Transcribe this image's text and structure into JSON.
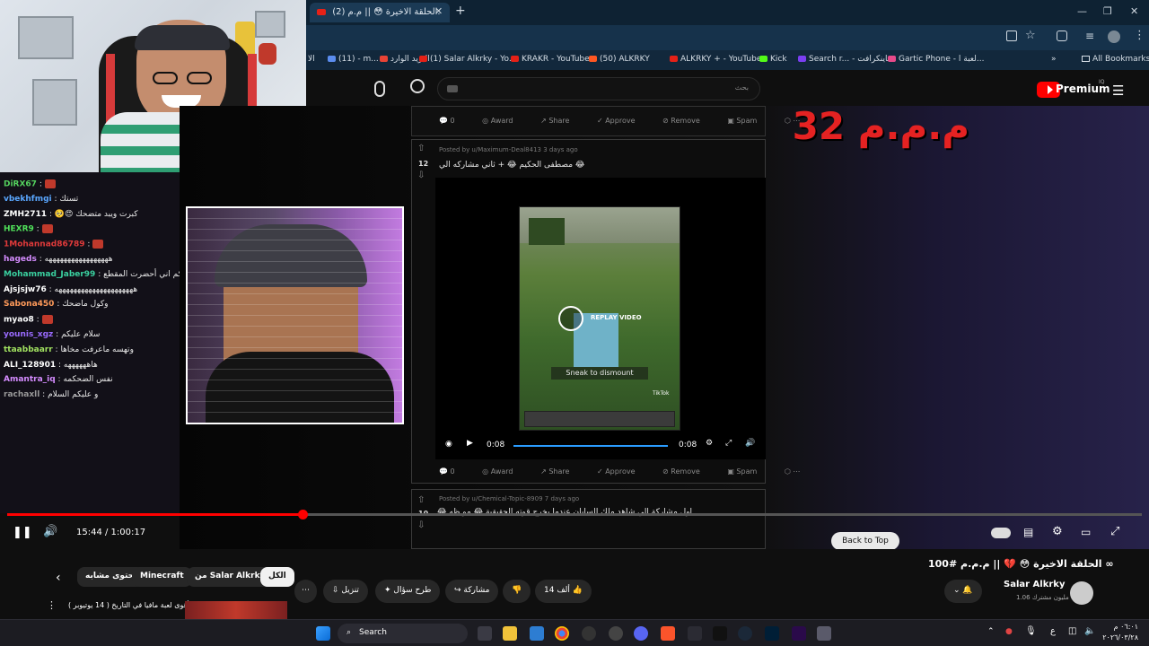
{
  "browser": {
    "tab_title": "(2) الحلقة الاخيرة 😳 || م.م.",
    "new_tab": "+",
    "window_controls": [
      "—",
      "❐",
      "✕"
    ],
    "bookmarks": [
      {
        "label": "الا"
      },
      {
        "label": "(11) - m..."
      },
      {
        "label": "البريد الوارد"
      },
      {
        "label": "(1) Salar Alkrky - Yo..."
      },
      {
        "label": "KRAKR - YouTube"
      },
      {
        "label": "(50) ALKRKY"
      },
      {
        "label": "ALKRKY + - YouTube"
      },
      {
        "label": "Kick"
      },
      {
        "label": "Search r... - ماينكرافت"
      },
      {
        "label": "Gartic Phone - لعبة ا..."
      },
      {
        "label": "All Bookmarks"
      }
    ]
  },
  "youtube": {
    "search_placeholder": "بحث",
    "premium_label": "Premium",
    "premium_badge": "IQ"
  },
  "chat": [
    {
      "user": "DiRX67",
      "msg": "",
      "color": "#54d15e"
    },
    {
      "user": "vbekhfmgi",
      "msg": "تستك",
      "color": "#5aa7ff"
    },
    {
      "user": "ZMH2711",
      "msg": "🥺😍 كبرت ويبد متضحك",
      "color": "#ffffff"
    },
    {
      "user": "HEXR9",
      "msg": "",
      "color": "#50e05a"
    },
    {
      "user": "1Mohannad86789",
      "msg": "",
      "color": "#e03a3a"
    },
    {
      "user": "hageds",
      "msg": "هههههههههههههههههه",
      "color": "#d58cff"
    },
    {
      "user": "Mohammad_Jaber99",
      "msg": "سلام عليكم اني أحضرت المقطع",
      "color": "#3ad1a0"
    },
    {
      "user": "Ajsjsjw76",
      "msg": "هههههههههههههههههههههه",
      "color": "#ffffff"
    },
    {
      "user": "Sabona450",
      "msg": "وكول ماضحك",
      "color": "#ff9a5a"
    },
    {
      "user": "myao8",
      "msg": "",
      "color": "#ffffff"
    },
    {
      "user": "younis_xgz",
      "msg": "سلام عليكم",
      "color": "#9a6bff"
    },
    {
      "user": "ttaabbaarr",
      "msg": "وتهسه ماعرفت مخاها",
      "color": "#a0e060"
    },
    {
      "user": "ALI_128901",
      "msg": "هاههههههه",
      "color": "#ffffff"
    },
    {
      "user": "Amantra_iq",
      "msg": "نفس الضحكمه",
      "color": "#d58cff"
    },
    {
      "user": "rachaxll",
      "msg": "و عليكم السلام",
      "color": "#9a9a9a"
    }
  ],
  "reddit": {
    "action_labels": [
      "0",
      "Award",
      "Share",
      "Approve",
      "Remove",
      "Spam"
    ],
    "post2": {
      "meta": "Posted by u/Maximum-Deal8413 3 days ago",
      "votes": "12",
      "title": "مصطفى الحكيم 😂 + ثاني مشاركه الي 😂",
      "replay_label": "REPLAY VIDEO",
      "overlay_text": "Sneak to dismount",
      "time_current": "0:08",
      "time_total": "0:08",
      "watermark": "TikTok"
    },
    "post3": {
      "meta": "Posted by u/Chemical-Topic-8909 7 days ago",
      "votes": "10",
      "title": "😂 اول مشاركة الي شاهد ملك السايان عندما يخرج قوته الحقيقية 😂 مو ظه"
    }
  },
  "overlay_text": "م.م.م 32",
  "player": {
    "time": "15:44 / 1:00:17",
    "progress": 0.26,
    "back_to_top": "Back to Top"
  },
  "below": {
    "chips": [
      "الكل",
      "من Salar Alkrky",
      "Minecraft",
      "محتوى مشابه"
    ],
    "video_title": "الحلقة الاخيرة 😳 💔 || م.م.م #100 ∞",
    "channel": "Salar Alkrky",
    "subscribers": "1.06 مليون مشترك",
    "likes": "14 ألف",
    "share": "مشاركة",
    "ask": "طرح سؤال",
    "download": "تنزيل",
    "more": "⋯",
    "suggested": "أقوى لعبة مافيا في التاريخ ( 14 يوتيوبر )"
  },
  "taskbar": {
    "search_label": "Search",
    "time": "٠٦:٠١ م",
    "date": "٢٠٢٦/٠٣/٢٨",
    "lang": "ع"
  },
  "colors": {
    "yt_red": "#ff0000",
    "accent_blue": "#2a9cff"
  }
}
